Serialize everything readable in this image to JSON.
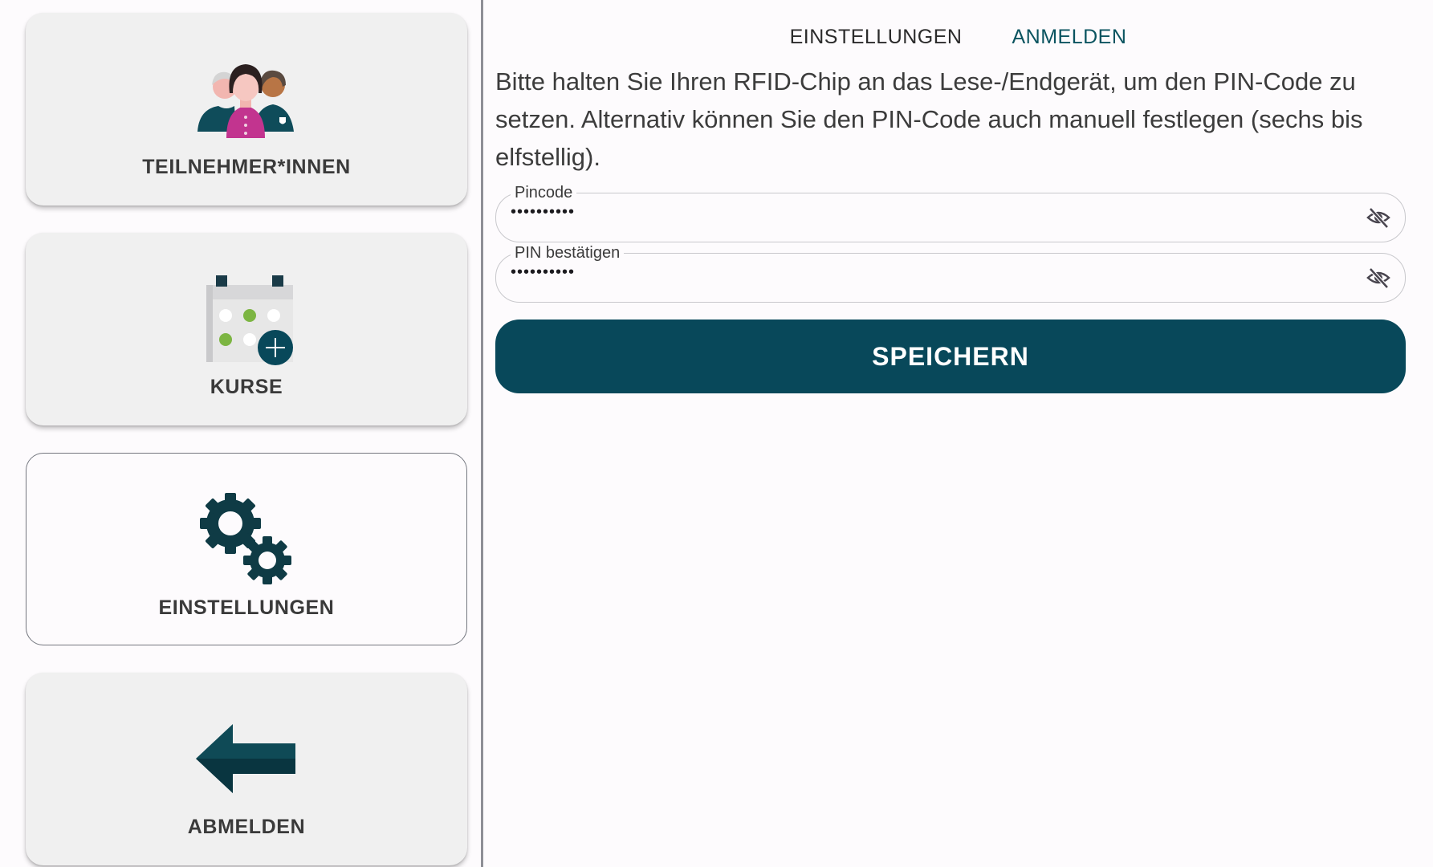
{
  "sidebar": {
    "items": [
      {
        "label": "TEILNEHMER*INNEN",
        "icon": "participants-icon",
        "active": false
      },
      {
        "label": "KURSE",
        "icon": "calendar-add-icon",
        "active": false
      },
      {
        "label": "EINSTELLUNGEN",
        "icon": "gears-icon",
        "active": true
      },
      {
        "label": "ABMELDEN",
        "icon": "arrow-left-icon",
        "active": false
      }
    ]
  },
  "tabs": [
    {
      "label": "EINSTELLUNGEN",
      "active": false
    },
    {
      "label": "ANMELDEN",
      "active": true
    }
  ],
  "main": {
    "instructions": "Bitte halten Sie Ihren RFID-Chip an das Lese-/Endgerät, um den PIN-Code zu setzen. Alternativ können Sie den PIN-Code auch manuell festlegen (sechs bis elfstellig).",
    "pincode": {
      "label": "Pincode",
      "value": "••••••••••"
    },
    "pin_confirm": {
      "label": "PIN bestätigen",
      "value": "••••••••••"
    },
    "save_label": "SPEICHERN"
  },
  "colors": {
    "accent": "#08485a",
    "active_tab": "#0b5460",
    "card_bg": "#f0f0f0",
    "page_bg": "#fdfbfd"
  }
}
